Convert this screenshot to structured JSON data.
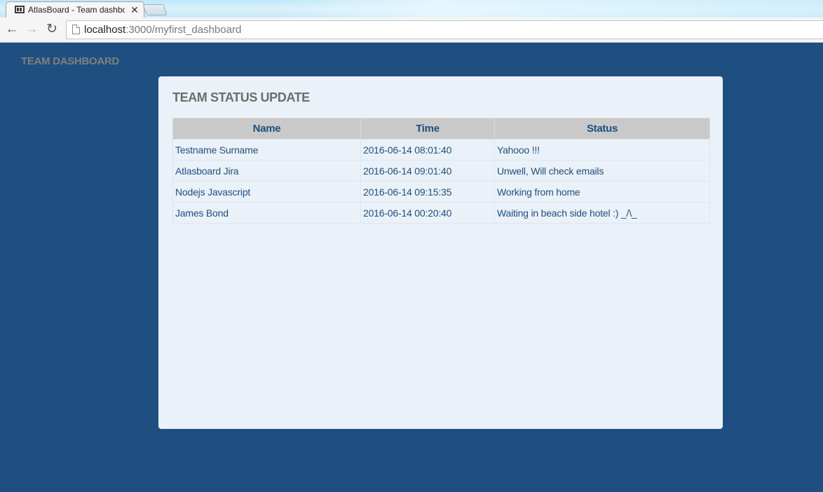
{
  "browser": {
    "tab_title": "AtlasBoard - Team dashboard",
    "url_host": "localhost",
    "url_path": ":3000/myfirst_dashboard"
  },
  "icons": {
    "tab": "dashboard-favicon",
    "close": "close-icon",
    "back": "back-arrow-icon",
    "forward": "forward-arrow-icon",
    "reload": "reload-icon",
    "page": "page-icon"
  },
  "dashboard": {
    "title": "TEAM DASHBOARD"
  },
  "widget": {
    "title": "TEAM STATUS UPDATE",
    "columns": {
      "name": "Name",
      "time": "Time",
      "status": "Status"
    },
    "rows": [
      {
        "name": "Testname Surname",
        "time": "2016-06-14 08:01:40",
        "status": "Yahooo !!!"
      },
      {
        "name": "Atlasboard Jira",
        "time": "2016-06-14 09:01:40",
        "status": "Unwell, Will check emails"
      },
      {
        "name": "Nodejs Javascript",
        "time": "2016-06-14 09:15:35",
        "status": "Working from home"
      },
      {
        "name": "James Bond",
        "time": "2016-06-14 00:20:40",
        "status": "Waiting in beach side hotel :) _/\\_"
      }
    ]
  },
  "colors": {
    "background": "#1f4f80",
    "widget_bg": "#ebf1f9",
    "header_bg": "#c9c9c9",
    "text_blue": "#1f4f80",
    "title_grey": "#6d6d6d"
  }
}
